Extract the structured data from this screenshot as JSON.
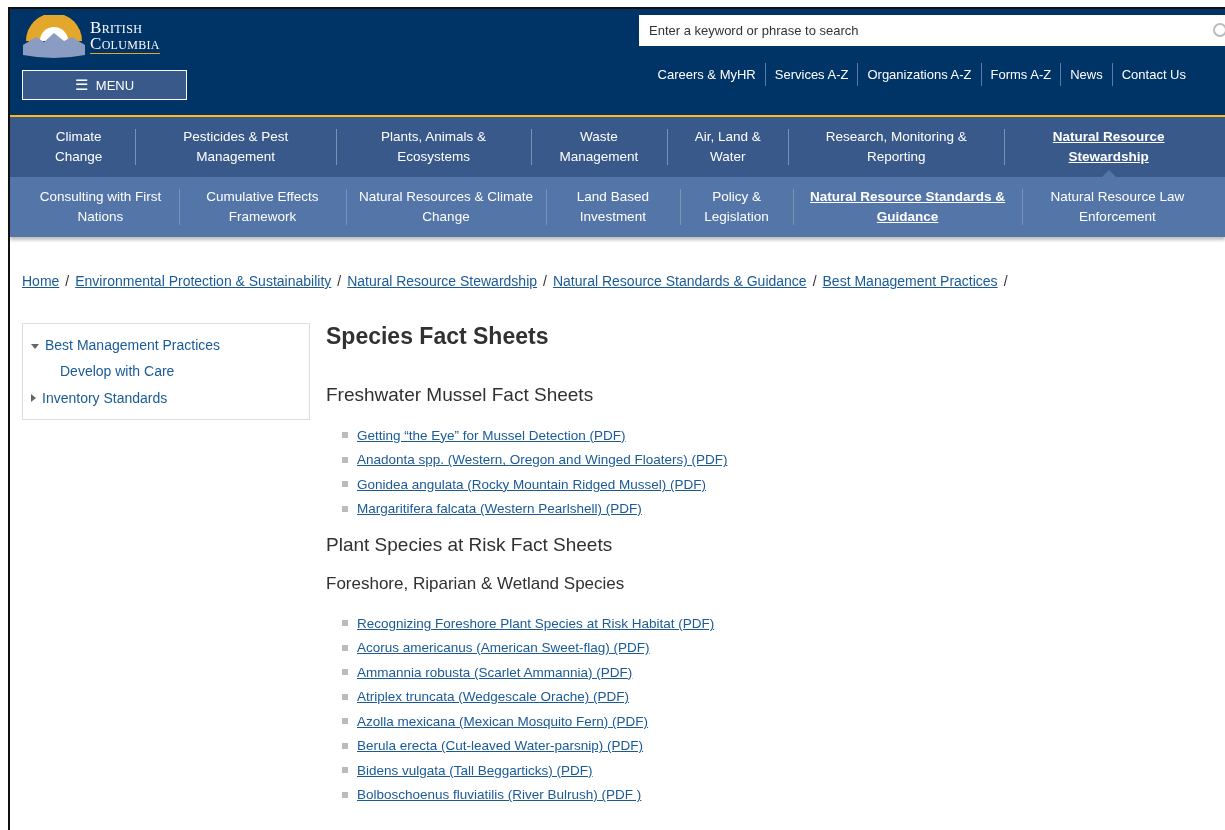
{
  "header": {
    "logo": {
      "line_1": "British",
      "line_2": "Columbia"
    },
    "menu_button": {
      "icon": "☰",
      "label": "MENU"
    },
    "search": {
      "placeholder": "Enter a keyword or phrase to search"
    },
    "utility_links": [
      "Careers & MyHR",
      "Services A-Z",
      "Organizations A-Z",
      "Forms A-Z",
      "News",
      "Contact Us"
    ]
  },
  "nav_primary": [
    {
      "label": "Climate Change",
      "selected": false
    },
    {
      "label": "Pesticides & Pest Management",
      "selected": false
    },
    {
      "label": "Plants, Animals & Ecosystems",
      "selected": false
    },
    {
      "label": "Waste Management",
      "selected": false
    },
    {
      "label": "Air, Land & Water",
      "selected": false
    },
    {
      "label": "Research, Monitoring & Reporting",
      "selected": false
    },
    {
      "label": "Natural Resource Stewardship",
      "selected": true
    }
  ],
  "nav_secondary": [
    {
      "label": "Consulting with First Nations",
      "selected": false
    },
    {
      "label": "Cumulative Effects Framework",
      "selected": false
    },
    {
      "label": "Natural Resources & Climate Change",
      "selected": false
    },
    {
      "label": "Land Based Investment",
      "selected": false
    },
    {
      "label": "Policy & Legislation",
      "selected": false
    },
    {
      "label": "Natural Resource Standards & Guidance",
      "selected": true
    },
    {
      "label": "Natural Resource Law Enforcement",
      "selected": false
    }
  ],
  "breadcrumb": [
    {
      "label": "Home",
      "separator": "/"
    },
    {
      "label": "Environmental Protection & Sustainability",
      "separator": "/"
    },
    {
      "label": "Natural Resource Stewardship",
      "separator": "/"
    },
    {
      "label": "Natural Resource Standards & Guidance",
      "separator": "/"
    },
    {
      "label": "Best Management Practices",
      "separator": "/"
    }
  ],
  "sidebar": {
    "items": [
      {
        "label": "Best Management Practices",
        "expanded": true,
        "children": [
          {
            "label": "Develop with Care"
          }
        ]
      },
      {
        "label": "Inventory Standards",
        "expanded": false
      }
    ]
  },
  "content": {
    "title": "Species Fact Sheets",
    "sections": [
      {
        "kind": "h2",
        "text": "Freshwater Mussel Fact Sheets"
      },
      {
        "kind": "links",
        "items": [
          "Getting “the Eye” for Mussel Detection (PDF)",
          "Anadonta spp. (Western, Oregon and Winged Floaters) (PDF)",
          "Gonidea angulata (Rocky Mountain Ridged Mussel) (PDF)",
          "Margaritifera falcata (Western Pearlshell) (PDF)"
        ]
      },
      {
        "kind": "h2",
        "text": "Plant Species at Risk Fact Sheets"
      },
      {
        "kind": "h3",
        "text": "Foreshore, Riparian & Wetland Species"
      },
      {
        "kind": "links",
        "items": [
          "Recognizing Foreshore Plant Species at Risk Habitat (PDF)",
          "Acorus americanus (American Sweet-flag) (PDF)",
          "Ammannia robusta (Scarlet Ammannia) (PDF)",
          "Atriplex truncata (Wedgescale Orache) (PDF)",
          "Azolla mexicana (Mexican Mosquito Fern) (PDF)",
          "Berula erecta (Cut-leaved Water-parsnip) (PDF)",
          "Bidens vulgata (Tall Beggarticks) (PDF)",
          "Bolboschoenus fluviatilis (River Bulrush) (PDF )"
        ]
      }
    ]
  }
}
